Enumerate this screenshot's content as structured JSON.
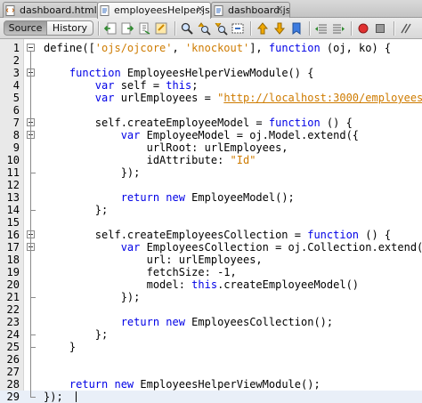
{
  "tabs": [
    {
      "label": "dashboard.html",
      "icon": "html-file-icon",
      "active": false
    },
    {
      "label": "employeesHelper.js",
      "icon": "js-file-icon",
      "active": true
    },
    {
      "label": "dashboard.js",
      "icon": "js-file-icon",
      "active": false
    }
  ],
  "toolbar": {
    "source_label": "Source",
    "history_label": "History",
    "buttons": [
      "back-icon",
      "forward-icon",
      "last-edit-icon",
      "find-icon",
      "find-previous-icon",
      "find-next-icon",
      "find-selection-icon",
      "toggle-highlight-icon",
      "toggle-rectangular-selection-icon",
      "previous-bookmark-icon",
      "next-bookmark-icon",
      "toggle-bookmark-icon",
      "shift-left-icon",
      "shift-right-icon",
      "start-macro-icon"
    ]
  },
  "editor": {
    "current_line": 29,
    "lines": [
      {
        "n": "1",
        "fold": "start",
        "tokens": [
          [
            "p",
            "define(["
          ],
          [
            "s",
            "'ojs/ojcore'"
          ],
          [
            "p",
            ", "
          ],
          [
            "s",
            "'knockout'"
          ],
          [
            "p",
            "], "
          ],
          [
            "k",
            "function"
          ],
          [
            "p",
            " (oj, ko) {"
          ]
        ]
      },
      {
        "n": "2",
        "tokens": []
      },
      {
        "n": "3",
        "fold": "start",
        "tokens": [
          [
            "p",
            "    "
          ],
          [
            "k",
            "function"
          ],
          [
            "p",
            " EmployeesHelperViewModule() {"
          ]
        ]
      },
      {
        "n": "4",
        "tokens": [
          [
            "p",
            "        "
          ],
          [
            "k",
            "var"
          ],
          [
            "p",
            " self = "
          ],
          [
            "k",
            "this"
          ],
          [
            "p",
            ";"
          ]
        ]
      },
      {
        "n": "5",
        "tokens": [
          [
            "p",
            "        "
          ],
          [
            "k",
            "var"
          ],
          [
            "p",
            " urlEmployees = "
          ],
          [
            "s",
            "\""
          ],
          [
            "u",
            "http://localhost:3000/employees"
          ],
          [
            "s",
            "\""
          ],
          [
            "p",
            ";"
          ]
        ]
      },
      {
        "n": "6",
        "tokens": []
      },
      {
        "n": "7",
        "fold": "start",
        "tokens": [
          [
            "p",
            "        self.createEmployeeModel = "
          ],
          [
            "k",
            "function"
          ],
          [
            "p",
            " () {"
          ]
        ]
      },
      {
        "n": "8",
        "fold": "start",
        "tokens": [
          [
            "p",
            "            "
          ],
          [
            "k",
            "var"
          ],
          [
            "p",
            " EmployeeModel = oj.Model.extend({"
          ]
        ]
      },
      {
        "n": "9",
        "tokens": [
          [
            "p",
            "                urlRoot: urlEmployees,"
          ]
        ]
      },
      {
        "n": "10",
        "tokens": [
          [
            "p",
            "                idAttribute: "
          ],
          [
            "s",
            "\"Id\""
          ]
        ]
      },
      {
        "n": "11",
        "fold": "end",
        "tokens": [
          [
            "p",
            "            });"
          ]
        ]
      },
      {
        "n": "12",
        "tokens": []
      },
      {
        "n": "13",
        "tokens": [
          [
            "p",
            "            "
          ],
          [
            "k",
            "return new"
          ],
          [
            "p",
            " EmployeeModel();"
          ]
        ]
      },
      {
        "n": "14",
        "fold": "end",
        "tokens": [
          [
            "p",
            "        };"
          ]
        ]
      },
      {
        "n": "15",
        "tokens": []
      },
      {
        "n": "16",
        "fold": "start",
        "tokens": [
          [
            "p",
            "        self.createEmployeesCollection = "
          ],
          [
            "k",
            "function"
          ],
          [
            "p",
            " () {"
          ]
        ]
      },
      {
        "n": "17",
        "fold": "start",
        "tokens": [
          [
            "p",
            "            "
          ],
          [
            "k",
            "var"
          ],
          [
            "p",
            " EmployeesCollection = oj.Collection.extend({"
          ]
        ]
      },
      {
        "n": "18",
        "tokens": [
          [
            "p",
            "                url: urlEmployees,"
          ]
        ]
      },
      {
        "n": "19",
        "tokens": [
          [
            "p",
            "                fetchSize: -1,"
          ]
        ]
      },
      {
        "n": "20",
        "tokens": [
          [
            "p",
            "                model: "
          ],
          [
            "k",
            "this"
          ],
          [
            "p",
            ".createEmployeeModel()"
          ]
        ]
      },
      {
        "n": "21",
        "fold": "end",
        "tokens": [
          [
            "p",
            "            });"
          ]
        ]
      },
      {
        "n": "22",
        "tokens": []
      },
      {
        "n": "23",
        "tokens": [
          [
            "p",
            "            "
          ],
          [
            "k",
            "return new"
          ],
          [
            "p",
            " EmployeesCollection();"
          ]
        ]
      },
      {
        "n": "24",
        "fold": "end",
        "tokens": [
          [
            "p",
            "        };"
          ]
        ]
      },
      {
        "n": "25",
        "fold": "end",
        "tokens": [
          [
            "p",
            "    }"
          ]
        ]
      },
      {
        "n": "26",
        "tokens": []
      },
      {
        "n": "27",
        "tokens": []
      },
      {
        "n": "28",
        "tokens": [
          [
            "p",
            "    "
          ],
          [
            "k",
            "return new"
          ],
          [
            "p",
            " EmployeesHelperViewModule();"
          ]
        ]
      },
      {
        "n": "29",
        "fold": "end",
        "tokens": [
          [
            "p",
            "});"
          ]
        ]
      }
    ]
  }
}
